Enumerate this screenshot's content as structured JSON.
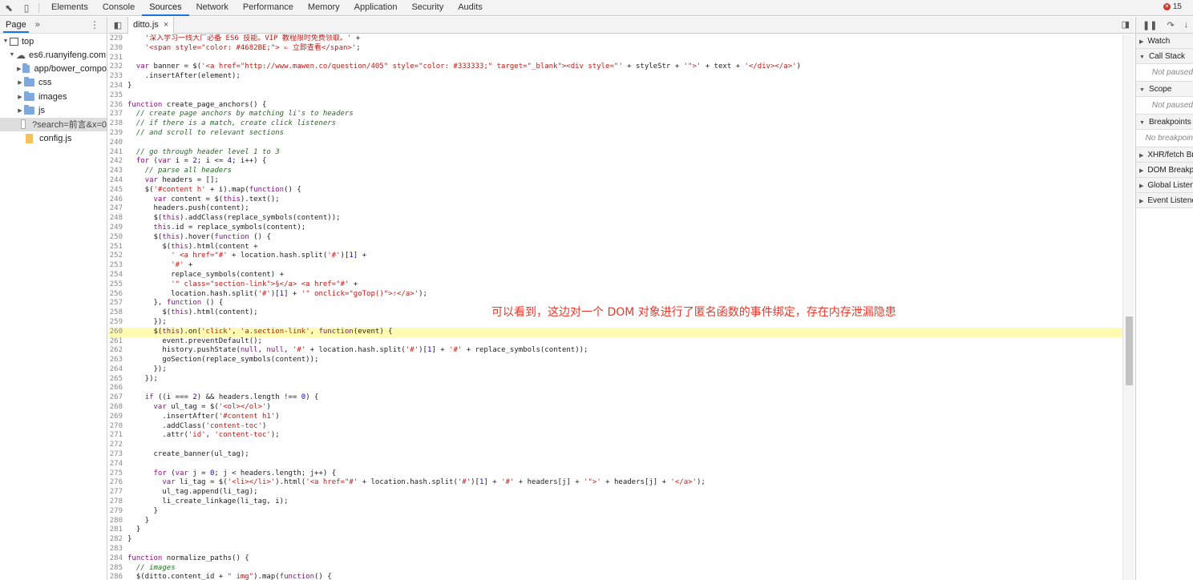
{
  "main_tabs": [
    "Elements",
    "Console",
    "Sources",
    "Network",
    "Performance",
    "Memory",
    "Application",
    "Security",
    "Audits"
  ],
  "active_tab": "Sources",
  "error_count": "15",
  "navigator": {
    "tab_label": "Page",
    "more": "»",
    "tree": [
      {
        "label": "top",
        "kind": "frame",
        "indent": 0,
        "open": true
      },
      {
        "label": "es6.ruanyifeng.com",
        "kind": "domain",
        "indent": 1,
        "open": true
      },
      {
        "label": "app/bower_compo",
        "kind": "folder",
        "indent": 2,
        "open": false
      },
      {
        "label": "css",
        "kind": "folder",
        "indent": 2,
        "open": false
      },
      {
        "label": "images",
        "kind": "folder",
        "indent": 2,
        "open": false
      },
      {
        "label": "js",
        "kind": "folder",
        "indent": 2,
        "open": false
      },
      {
        "label": "?search=前言&x=0",
        "kind": "doc",
        "indent": 2,
        "selected": true
      },
      {
        "label": "config.js",
        "kind": "file",
        "indent": 2
      }
    ]
  },
  "editor": {
    "file_tab": "ditto.js",
    "close_glyph": "×",
    "highlight_line": 260,
    "lines": [
      {
        "n": 229,
        "t": "    '深入学习一线大厂必备 ES6 技能。VIP 教程限时免费领取。' +"
      },
      {
        "n": 230,
        "t": "    '<span style=\"color: #4682BE;\"> ⇐ 立即查看</span>';"
      },
      {
        "n": 231,
        "t": ""
      },
      {
        "n": 232,
        "t": "  var banner = $('<a href=\"http://www.mawen.co/question/405\" style=\"color: #333333;\" target=\"_blank\"><div style=\"' + styleStr + '\">' + text + '</div></a>')"
      },
      {
        "n": 233,
        "t": "    .insertAfter(element);"
      },
      {
        "n": 234,
        "t": "}"
      },
      {
        "n": 235,
        "t": ""
      },
      {
        "n": 236,
        "t": "function create_page_anchors() {"
      },
      {
        "n": 237,
        "t": "  // create page anchors by matching li's to headers"
      },
      {
        "n": 238,
        "t": "  // if there is a match, create click listeners"
      },
      {
        "n": 239,
        "t": "  // and scroll to relevant sections"
      },
      {
        "n": 240,
        "t": ""
      },
      {
        "n": 241,
        "t": "  // go through header level 1 to 3"
      },
      {
        "n": 242,
        "t": "  for (var i = 2; i <= 4; i++) {"
      },
      {
        "n": 243,
        "t": "    // parse all headers"
      },
      {
        "n": 244,
        "t": "    var headers = [];"
      },
      {
        "n": 245,
        "t": "    $('#content h' + i).map(function() {"
      },
      {
        "n": 246,
        "t": "      var content = $(this).text();"
      },
      {
        "n": 247,
        "t": "      headers.push(content);"
      },
      {
        "n": 248,
        "t": "      $(this).addClass(replace_symbols(content));"
      },
      {
        "n": 249,
        "t": "      this.id = replace_symbols(content);"
      },
      {
        "n": 250,
        "t": "      $(this).hover(function () {"
      },
      {
        "n": 251,
        "t": "        $(this).html(content +"
      },
      {
        "n": 252,
        "t": "          ' <a href=\"#' + location.hash.split('#')[1] +"
      },
      {
        "n": 253,
        "t": "          '#' +"
      },
      {
        "n": 254,
        "t": "          replace_symbols(content) +"
      },
      {
        "n": 255,
        "t": "          '\" class=\"section-link\">§</a> <a href=\"#' +"
      },
      {
        "n": 256,
        "t": "          location.hash.split('#')[1] + '\" onclick=\"goTop()\">⇧</a>');"
      },
      {
        "n": 257,
        "t": "      }, function () {"
      },
      {
        "n": 258,
        "t": "        $(this).html(content);"
      },
      {
        "n": 259,
        "t": "      });"
      },
      {
        "n": 260,
        "t": "      $(this).on('click', 'a.section-link', function(event) {"
      },
      {
        "n": 261,
        "t": "        event.preventDefault();"
      },
      {
        "n": 262,
        "t": "        history.pushState(null, null, '#' + location.hash.split('#')[1] + '#' + replace_symbols(content));"
      },
      {
        "n": 263,
        "t": "        goSection(replace_symbols(content));"
      },
      {
        "n": 264,
        "t": "      });"
      },
      {
        "n": 265,
        "t": "    });"
      },
      {
        "n": 266,
        "t": ""
      },
      {
        "n": 267,
        "t": "    if ((i === 2) && headers.length !== 0) {"
      },
      {
        "n": 268,
        "t": "      var ul_tag = $('<ol></ol>')"
      },
      {
        "n": 269,
        "t": "        .insertAfter('#content h1')"
      },
      {
        "n": 270,
        "t": "        .addClass('content-toc')"
      },
      {
        "n": 271,
        "t": "        .attr('id', 'content-toc');"
      },
      {
        "n": 272,
        "t": ""
      },
      {
        "n": 273,
        "t": "      create_banner(ul_tag);"
      },
      {
        "n": 274,
        "t": ""
      },
      {
        "n": 275,
        "t": "      for (var j = 0; j < headers.length; j++) {"
      },
      {
        "n": 276,
        "t": "        var li_tag = $('<li></li>').html('<a href=\"#' + location.hash.split('#')[1] + '#' + headers[j] + '\">' + headers[j] + '</a>');"
      },
      {
        "n": 277,
        "t": "        ul_tag.append(li_tag);"
      },
      {
        "n": 278,
        "t": "        li_create_linkage(li_tag, i);"
      },
      {
        "n": 279,
        "t": "      }"
      },
      {
        "n": 280,
        "t": "    }"
      },
      {
        "n": 281,
        "t": "  }"
      },
      {
        "n": 282,
        "t": "}"
      },
      {
        "n": 283,
        "t": ""
      },
      {
        "n": 284,
        "t": "function normalize_paths() {"
      },
      {
        "n": 285,
        "t": "  // images"
      },
      {
        "n": 286,
        "t": "  $(ditto.content_id + \" img\").map(function() {"
      }
    ]
  },
  "annotation": "可以看到，这边对一个 DOM 对象进行了匿名函数的事件绑定，存在内存泄漏隐患",
  "debugger": {
    "panes": [
      {
        "title": "Watch",
        "open": false
      },
      {
        "title": "Call Stack",
        "open": true,
        "body": "Not paused"
      },
      {
        "title": "Scope",
        "open": true,
        "body": "Not paused"
      },
      {
        "title": "Breakpoints",
        "open": true,
        "body": "No breakpoin"
      },
      {
        "title": "XHR/fetch Br",
        "open": false
      },
      {
        "title": "DOM Breakp",
        "open": false
      },
      {
        "title": "Global Listen",
        "open": false
      },
      {
        "title": "Event Listene",
        "open": false
      }
    ]
  },
  "colors": {
    "accent": "#1a73e8",
    "highlight_line_bg": "#fffbb0",
    "annotation_red": "#e8382a",
    "error_red": "#d93025",
    "folder_blue": "#7fa9dc"
  },
  "icons": {
    "inspect": "cursor-arrow-icon",
    "device": "device-toggle-icon",
    "error": "error-circle-icon",
    "pause": "pause-icon",
    "step_over": "step-over-icon",
    "step_into": "step-into-icon"
  }
}
